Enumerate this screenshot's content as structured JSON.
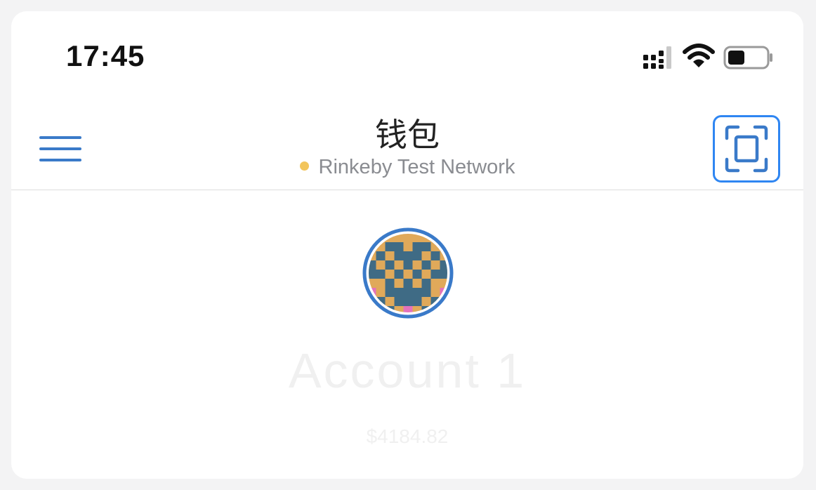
{
  "status_bar": {
    "time": "17:45",
    "icons": [
      "cellular-signal-icon",
      "wifi-icon",
      "battery-icon"
    ],
    "battery_level": 0.45
  },
  "header": {
    "title": "钱包",
    "network": "Rinkeby Test Network",
    "network_dot_color": "#f2c55c",
    "menu_icon": "hamburger-menu-icon",
    "scan_icon": "qr-scan-icon",
    "accent_color": "#3a7ac9"
  },
  "account": {
    "name": "Account 1",
    "balance": "$4184.82",
    "avatar_ring_color": "#3a7ac9"
  }
}
